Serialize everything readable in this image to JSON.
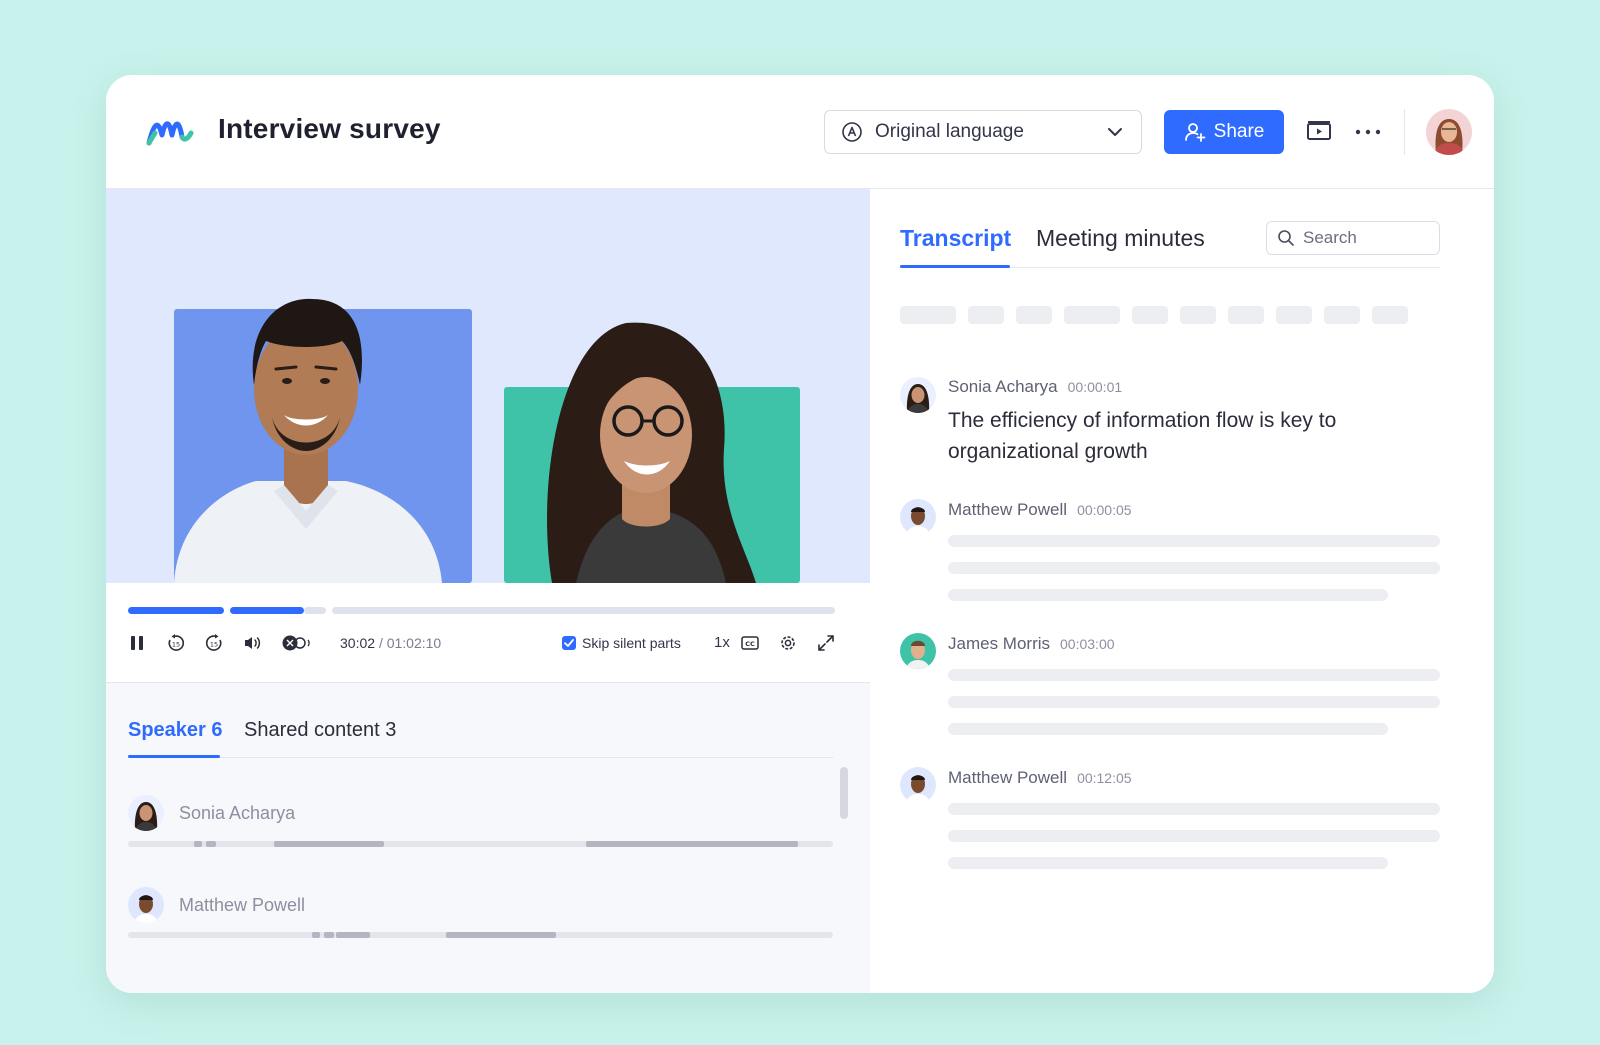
{
  "app": {
    "title": "Interview survey"
  },
  "header": {
    "language_label": "Original language",
    "share_label": "Share",
    "icons": [
      "logo-icon",
      "translate-icon",
      "chevron-down-icon",
      "add-user-icon",
      "present-icon",
      "more-icon",
      "avatar"
    ]
  },
  "player": {
    "current_time": "30:02",
    "duration": "/ 01:02:10",
    "skip_silent_label": "Skip silent parts",
    "skip_silent_checked": true,
    "speed_label": "1x"
  },
  "lower_tabs": [
    {
      "label": "Speaker 6",
      "active": true
    },
    {
      "label": "Shared content 3",
      "active": false
    }
  ],
  "speakers": [
    {
      "name": "Sonia Acharya"
    },
    {
      "name": "Matthew Powell"
    }
  ],
  "right_tabs": [
    {
      "label": "Transcript",
      "active": true
    },
    {
      "label": "Meeting minutes",
      "active": false
    }
  ],
  "search": {
    "placeholder": "Search"
  },
  "transcript": [
    {
      "name": "Sonia Acharya",
      "time": "00:00:01",
      "text": "The efficiency of information flow is key to organizational growth"
    },
    {
      "name": "Matthew Powell",
      "time": "00:00:05",
      "text": ""
    },
    {
      "name": "James Morris",
      "time": "00:03:00",
      "text": ""
    },
    {
      "name": "Matthew Powell",
      "time": "00:12:05",
      "text": ""
    }
  ],
  "colors": {
    "accent": "#2f6bff",
    "background": "#c8f3ec",
    "video_bg": "#e0e8fd",
    "tile_blue": "#6f95ee",
    "tile_teal": "#3ec3a9"
  }
}
